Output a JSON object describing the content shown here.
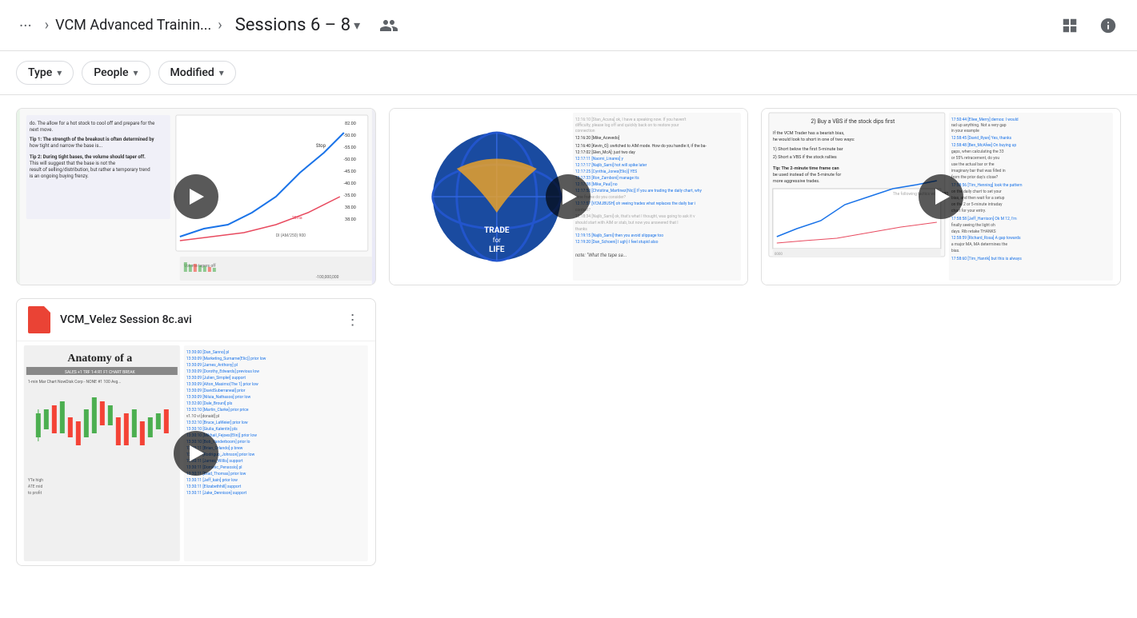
{
  "header": {
    "dots_label": "···",
    "chevron": "›",
    "breadcrumb_title": "VCM Advanced Trainin...",
    "sessions_title": "Sessions 6 – 8",
    "people_icon": "👥",
    "grid_icon": "⊞",
    "info_icon": "ⓘ"
  },
  "filters": {
    "type_label": "Type",
    "people_label": "People",
    "modified_label": "Modified",
    "dropdown_arrow": "▾"
  },
  "thumbnails": [
    {
      "id": "thumb-1",
      "type": "video",
      "has_play": true
    },
    {
      "id": "thumb-2",
      "type": "video",
      "has_play": true,
      "logo": "TRADE\nfor\nLIFE"
    },
    {
      "id": "thumb-3",
      "type": "video",
      "has_play": true
    }
  ],
  "file_item": {
    "icon_color": "#ea4335",
    "name": "VCM_Velez Session 8c.avi",
    "more_icon": "⋮",
    "thumb_type": "anatomy"
  },
  "more_icon": "⋮",
  "play_icon": "▶"
}
